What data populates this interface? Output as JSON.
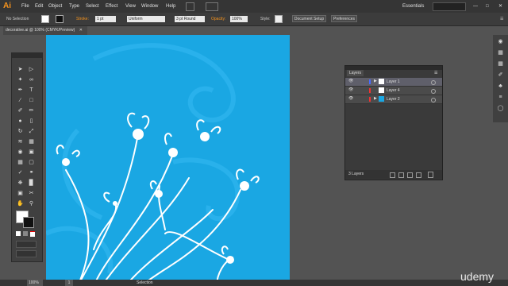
{
  "app": {
    "logo": "Ai"
  },
  "menu": {
    "items": [
      "File",
      "Edit",
      "Object",
      "Type",
      "Select",
      "Effect",
      "View",
      "Window",
      "Help"
    ],
    "workspace": "Essentials"
  },
  "control_bar": {
    "selection_label": "No Selection",
    "stroke_label": "Stroke:",
    "stroke_value": "1 pt",
    "profile_value": "Uniform",
    "brush_value": "3 pt Round",
    "opacity_label": "Opacity:",
    "opacity_value": "100%",
    "style_label": "Style:",
    "document_setup": "Document Setup",
    "preferences": "Preferences"
  },
  "document": {
    "tab_title": "decorative.ai @ 100% (CMYK/Preview)"
  },
  "colors": {
    "artboard": "#1aa7e3",
    "accent": "#f7941d"
  },
  "layers_panel": {
    "title": "Layers",
    "layers": [
      {
        "name": "Layer 1",
        "color": "#ffffff",
        "selected": true
      },
      {
        "name": "Layer 4",
        "color": "#ffffff",
        "selected": false
      },
      {
        "name": "Layer 2",
        "color": "#1aa7e3",
        "selected": false
      }
    ],
    "count": "3 Layers"
  },
  "status": {
    "zoom": "100%",
    "page": "1",
    "tool": "Selection"
  },
  "watermark": "udemy"
}
